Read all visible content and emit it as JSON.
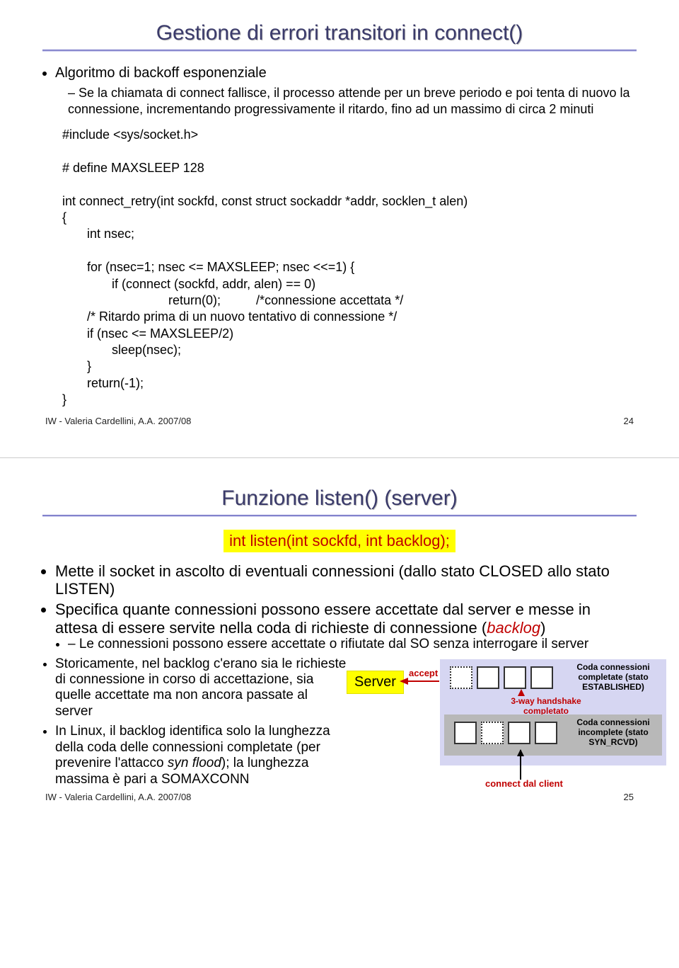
{
  "slide1": {
    "title": "Gestione di errori transitori in connect()",
    "bullet1": "Algoritmo di backoff esponenziale",
    "sub1": "Se la chiamata di connect fallisce, il processo attende per un breve periodo e poi tenta di nuovo la connessione, incrementando progressivamente il ritardo, fino ad un massimo di circa 2 minuti",
    "code": "#include <sys/socket.h>\n\n# define MAXSLEEP 128\n\nint connect_retry(int sockfd, const struct sockaddr *addr, socklen_t alen)\n{\n       int nsec;\n\n       for (nsec=1; nsec <= MAXSLEEP; nsec <<=1) {\n              if (connect (sockfd, addr, alen) == 0)\n                              return(0);          /*connessione accettata */\n       /* Ritardo prima di un nuovo tentativo di connessione */\n       if (nsec <= MAXSLEEP/2)\n              sleep(nsec);\n       }\n       return(-1);\n}",
    "footer_left": "IW - Valeria Cardellini, A.A. 2007/08",
    "footer_right": "24"
  },
  "slide2": {
    "title": "Funzione listen() (server)",
    "signature": "int listen(int sockfd, int backlog);",
    "b1a": "Mette il socket in ascolto di eventuali connessioni (dallo stato CLOSED allo stato LISTEN)",
    "b2a": "Specifica quante connessioni possono essere accettate dal server e messe in attesa di essere servite nella coda di richieste di connessione (",
    "b2_term": "backlog",
    "b2b": ")",
    "b2_sub": "Le connessioni possono essere accettate o rifiutate dal SO senza interrogare il server",
    "b3": "Storicamente, nel backlog c'erano sia le richieste di connessione in corso di accettazione, sia quelle accettate ma non ancora passate al server",
    "b4a": "In Linux, il backlog identifica solo la lunghezza della coda delle connessioni completate (per prevenire l'attacco ",
    "b4_term": "syn flood",
    "b4b": "); la lunghezza massima è pari a SOMAXCONN",
    "diag": {
      "server": "Server",
      "accept": "accept",
      "q1_label": "Coda connessioni completate (stato ESTABLISHED)",
      "handshake": "3-way handshake completato",
      "q2_label": "Coda connessioni incomplete (stato SYN_RCVD)",
      "connect": "connect dal client"
    },
    "footer_left": "IW - Valeria Cardellini, A.A. 2007/08",
    "footer_right": "25"
  }
}
